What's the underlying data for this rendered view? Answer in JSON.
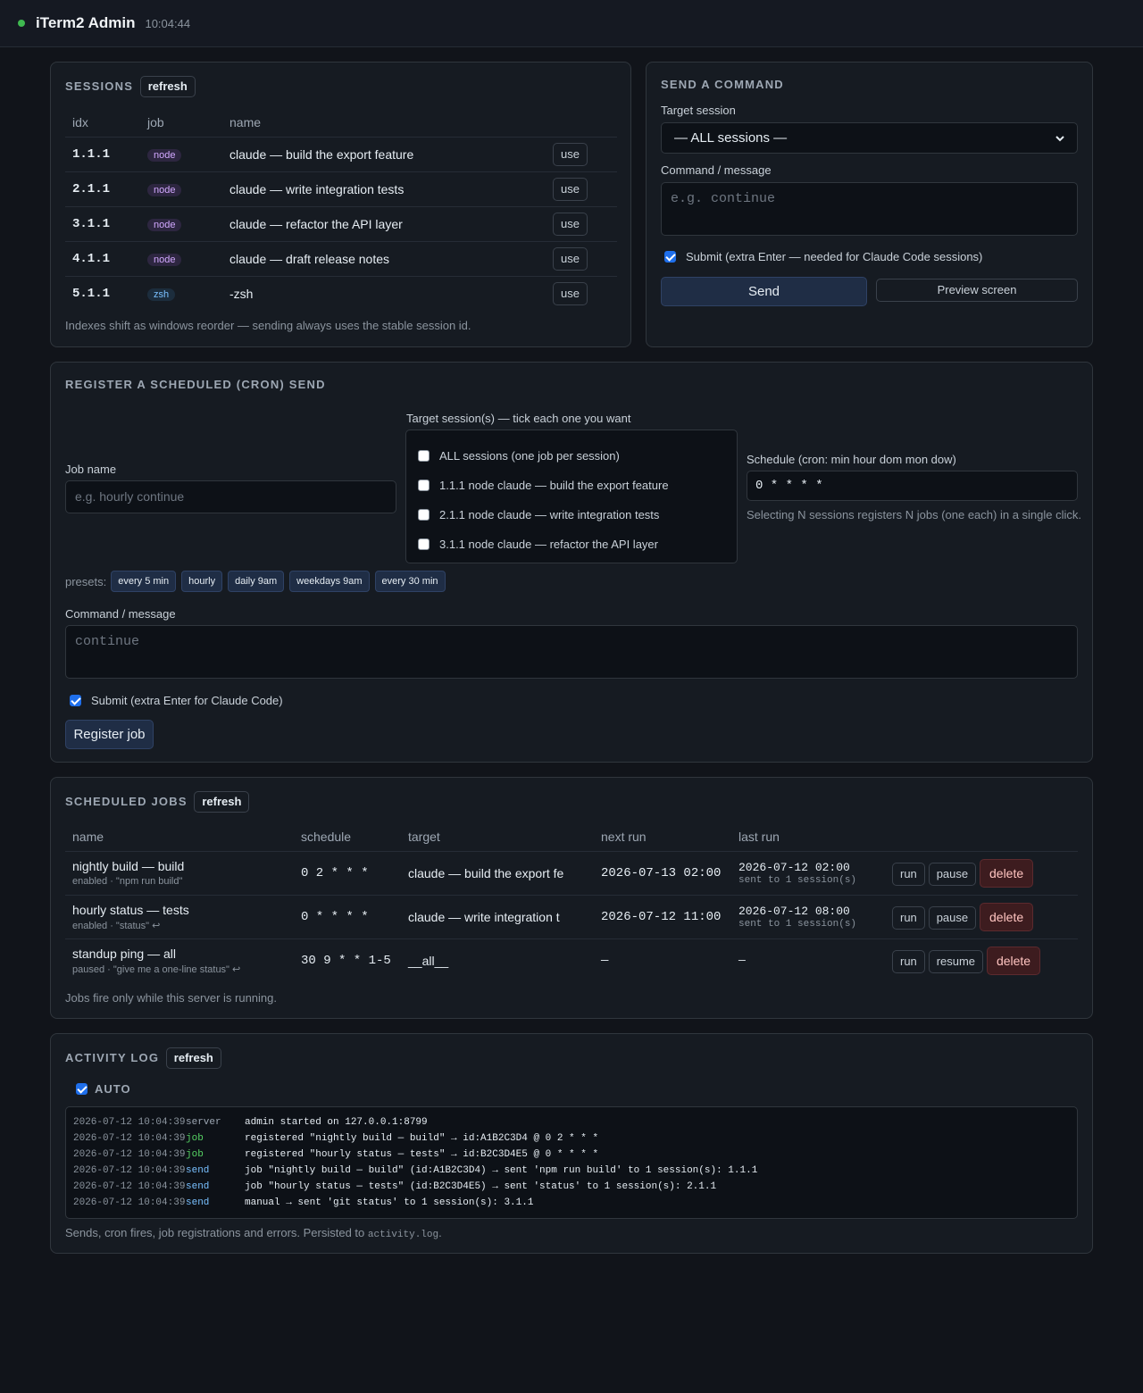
{
  "header": {
    "title": "iTerm2 Admin",
    "time": "10:04:44"
  },
  "sessions": {
    "title": "SESSIONS",
    "refresh": "refresh",
    "columns": [
      "idx",
      "job",
      "name"
    ],
    "use_label": "use",
    "rows": [
      {
        "idx": "1.1.1",
        "job": "node",
        "name": "claude — build the export feature"
      },
      {
        "idx": "2.1.1",
        "job": "node",
        "name": "claude — write integration tests"
      },
      {
        "idx": "3.1.1",
        "job": "node",
        "name": "claude — refactor the API layer"
      },
      {
        "idx": "4.1.1",
        "job": "node",
        "name": "claude — draft release notes"
      },
      {
        "idx": "5.1.1",
        "job": "zsh",
        "name": "-zsh"
      }
    ],
    "note": "Indexes shift as windows reorder — sending always uses the stable session id."
  },
  "send": {
    "title": "SEND A COMMAND",
    "target_label": "Target session",
    "target_value": "— ALL sessions —",
    "command_label": "Command / message",
    "command_placeholder": "e.g. continue",
    "submit_label": "Submit (extra Enter — needed for Claude Code sessions)",
    "submit_checked": true,
    "send_button": "Send",
    "preview_button": "Preview screen"
  },
  "register": {
    "title": "REGISTER A SCHEDULED (CRON) SEND",
    "job_name_label": "Job name",
    "job_name_placeholder": "e.g. hourly continue",
    "targets_label": "Target session(s) — tick each one you want",
    "targets": [
      {
        "label": "ALL sessions (one job per session)",
        "checked": false
      },
      {
        "label": "1.1.1 node claude — build the export feature",
        "checked": false
      },
      {
        "label": "2.1.1 node claude — write integration tests",
        "checked": false
      },
      {
        "label": "3.1.1 node claude — refactor the API layer",
        "checked": false
      }
    ],
    "schedule_label": "Schedule (cron: min hour dom mon dow)",
    "schedule_value": "0 * * * *",
    "schedule_hint": "Selecting N sessions registers N jobs (one each) in a single click.",
    "presets_label": "presets:",
    "presets": [
      "every 5 min",
      "hourly",
      "daily 9am",
      "weekdays 9am",
      "every 30 min"
    ],
    "command_label": "Command / message",
    "command_placeholder": "continue",
    "submit_label": "Submit (extra Enter for Claude Code)",
    "submit_checked": true,
    "register_button": "Register job"
  },
  "jobs": {
    "title": "SCHEDULED JOBS",
    "refresh": "refresh",
    "columns": [
      "name",
      "schedule",
      "target",
      "next run",
      "last run"
    ],
    "rows": [
      {
        "name": "nightly build — build",
        "sub": "enabled · \"npm run build\"",
        "schedule": "0 2 * * *",
        "target": "claude — build the export fe",
        "next": "2026-07-13 02:00",
        "last": "2026-07-12 02:00",
        "last_sub": "sent to 1 session(s)",
        "toggle": "pause"
      },
      {
        "name": "hourly status — tests",
        "sub": "enabled · \"status\" ↩",
        "schedule": "0 * * * *",
        "target": "claude — write integration t",
        "next": "2026-07-12 11:00",
        "last": "2026-07-12 08:00",
        "last_sub": "sent to 1 session(s)",
        "toggle": "pause"
      },
      {
        "name": "standup ping — all",
        "sub": "paused · \"give me a one-line status\" ↩",
        "schedule": "30 9 * * 1-5",
        "target": "__all__",
        "next": "—",
        "last": "—",
        "last_sub": "",
        "toggle": "resume"
      }
    ],
    "run_label": "run",
    "delete_label": "delete",
    "note": "Jobs fire only while this server is running."
  },
  "log": {
    "title": "ACTIVITY LOG",
    "refresh": "refresh",
    "auto_label": "AUTO",
    "auto_checked": true,
    "lines": [
      {
        "ts": "2026-07-12 10:04:39",
        "kind": "server",
        "msg": "admin started on 127.0.0.1:8799"
      },
      {
        "ts": "2026-07-12 10:04:39",
        "kind": "job",
        "msg": "registered \"nightly build — build\" → id:A1B2C3D4 @ 0 2 * * *"
      },
      {
        "ts": "2026-07-12 10:04:39",
        "kind": "job",
        "msg": "registered \"hourly status — tests\" → id:B2C3D4E5 @ 0 * * * *"
      },
      {
        "ts": "2026-07-12 10:04:39",
        "kind": "send",
        "msg": "job \"nightly build — build\" (id:A1B2C3D4) → sent 'npm run build' to 1 session(s): 1.1.1"
      },
      {
        "ts": "2026-07-12 10:04:39",
        "kind": "send",
        "msg": "job \"hourly status — tests\" (id:B2C3D4E5) → sent 'status' to 1 session(s): 2.1.1"
      },
      {
        "ts": "2026-07-12 10:04:39",
        "kind": "send",
        "msg": "manual → sent 'git status' to 1 session(s): 3.1.1"
      }
    ],
    "note_prefix": "Sends, cron fires, job registrations and errors. Persisted to ",
    "note_file": "activity.log",
    "note_suffix": "."
  },
  "colors": {
    "background": "#11141a",
    "card": "#161b22",
    "primary": "#1f2d45",
    "danger": "#3d1c1f",
    "status_ok": "#3fb950"
  }
}
